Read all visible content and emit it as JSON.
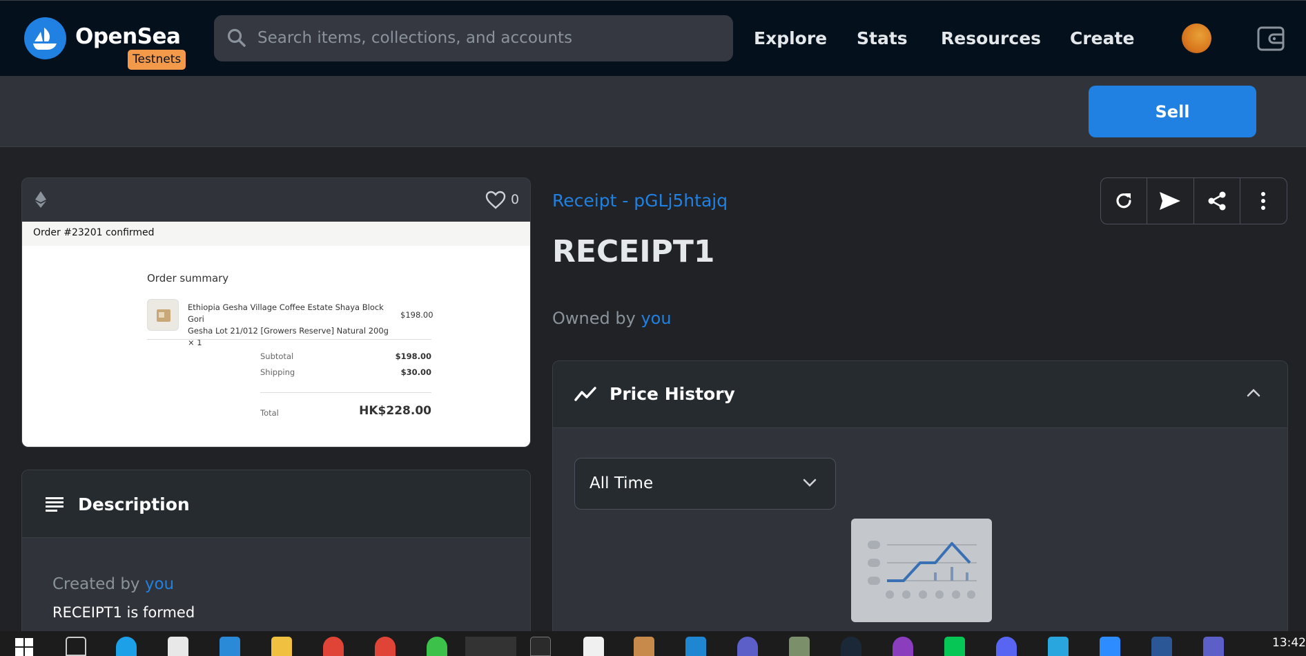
{
  "app": {
    "name": "OpenSea",
    "badge": "Testnets"
  },
  "nav": {
    "search_placeholder": "Search items, collections, and accounts",
    "links": [
      "Explore",
      "Stats",
      "Resources",
      "Create"
    ]
  },
  "sellbar": {
    "sell_label": "Sell"
  },
  "asset": {
    "favorites": "0",
    "collection": "Receipt - pGLj5htajq",
    "title": "RECEIPT1",
    "owned_prefix": "Owned by",
    "owner": "you"
  },
  "receipt_image": {
    "order": "Order #23201 confirmed",
    "summary": "Order summary",
    "item_line1": "Ethiopia Gesha Village Coffee Estate Shaya Block Gori",
    "item_line2": "Gesha Lot 21/012 [Growers Reserve] Natural 200g × 1",
    "item_price": "$198.00",
    "subtotal_label": "Subtotal",
    "subtotal_value": "$198.00",
    "shipping_label": "Shipping",
    "shipping_value": "$30.00",
    "total_label": "Total",
    "total_value": "HK$228.00"
  },
  "description": {
    "title": "Description",
    "created_prefix": "Created by",
    "creator": "you",
    "text": "RECEIPT1 is formed"
  },
  "price_history": {
    "title": "Price History",
    "range": "All Time"
  },
  "taskbar": {
    "time": "13:42"
  },
  "colors": {
    "accent": "#2081e2",
    "nav_bg": "#04111d",
    "card_bg": "#303339",
    "badge": "#f2994a"
  }
}
